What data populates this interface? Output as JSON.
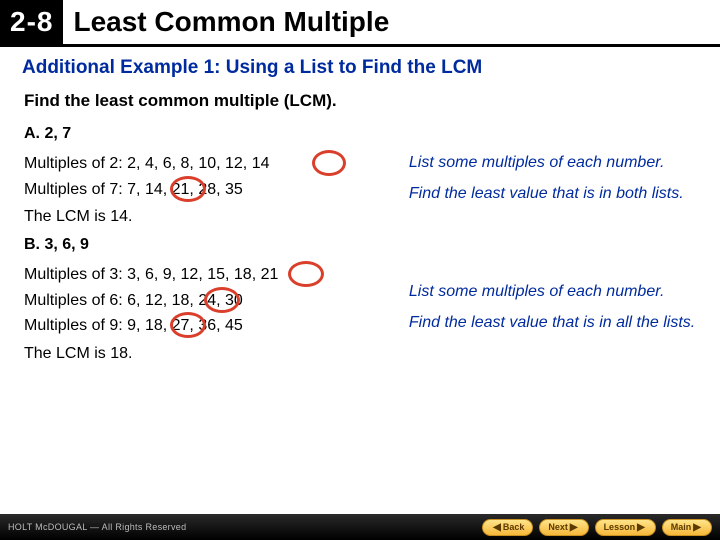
{
  "header": {
    "num": "2-8",
    "title": "Least Common Multiple"
  },
  "subtitle": "Additional Example 1: Using a List to Find the LCM",
  "instruction": "Find the least common multiple (LCM).",
  "partA": {
    "label": "A. 2, 7",
    "line1": "Multiples of 2: 2, 4, 6, 8, 10, 12, 14",
    "line2": "Multiples of 7: 7, 14, 21, 28, 35",
    "result": "The LCM is 14.",
    "hint1": "List some multiples of each number.",
    "hint2": "Find the least value that is in both lists."
  },
  "partB": {
    "label": "B. 3, 6, 9",
    "line1": "Multiples of 3: 3, 6, 9, 12, 15, 18, 21",
    "line2": "Multiples of 6: 6, 12, 18, 24, 30",
    "line3": "Multiples of 9: 9, 18, 27, 36, 45",
    "result": "The LCM is 18.",
    "hint1": "List some multiples of each number.",
    "hint2": "Find the least value that is in all the lists."
  },
  "footer": {
    "brand": "HOLT McDOUGAL — All Rights Reserved",
    "back": "Back",
    "next": "Next",
    "lesson": "Lesson",
    "main": "Main"
  }
}
